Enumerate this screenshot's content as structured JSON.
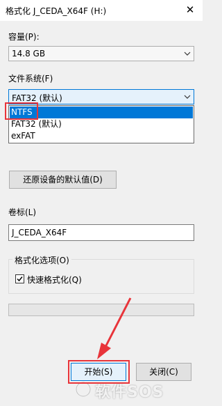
{
  "window": {
    "title": "格式化 J_CEDA_X64F (H:)",
    "close_glyph": "✕"
  },
  "capacity": {
    "label": "容量(P):",
    "value": "14.8 GB"
  },
  "filesystem": {
    "label": "文件系统(F)",
    "value": "FAT32 (默认)",
    "options": [
      "NTFS",
      "FAT32 (默认)",
      "exFAT"
    ],
    "highlighted": "NTFS"
  },
  "restore_button": "还原设备的默认值(D)",
  "volume": {
    "label": "卷标(L)",
    "value": "J_CEDA_X64F"
  },
  "format_options": {
    "legend": "格式化选项(O)",
    "quick_format_label": "快速格式化(Q)",
    "quick_format_checked": true
  },
  "progress": {
    "percent": 0
  },
  "buttons": {
    "start": "开始(S)",
    "close": "关闭(C)"
  },
  "annotation_color": "#e8343a",
  "watermark": {
    "text": "软件SOS"
  }
}
